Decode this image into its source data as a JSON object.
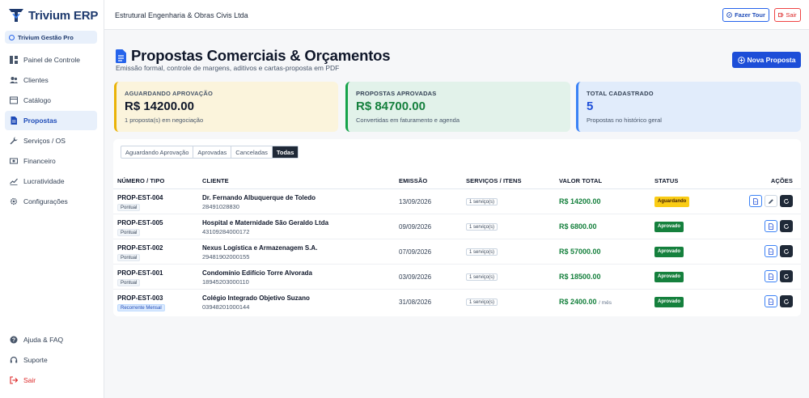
{
  "app": {
    "name": "Trivium ERP",
    "plan": "Trivium Gestão Pro"
  },
  "sidebar": {
    "items": [
      {
        "label": "Painel de Controle",
        "icon": "dashboard-icon",
        "active": false
      },
      {
        "label": "Clientes",
        "icon": "users-icon",
        "active": false
      },
      {
        "label": "Catálogo",
        "icon": "catalog-icon",
        "active": false
      },
      {
        "label": "Propostas",
        "icon": "document-icon",
        "active": true
      },
      {
        "label": "Serviços / OS",
        "icon": "wrench-icon",
        "active": false
      },
      {
        "label": "Financeiro",
        "icon": "money-icon",
        "active": false
      },
      {
        "label": "Lucratividade",
        "icon": "trend-icon",
        "active": false
      },
      {
        "label": "Configurações",
        "icon": "gear-icon",
        "active": false
      }
    ],
    "bottom": [
      {
        "label": "Ajuda & FAQ",
        "icon": "help-icon"
      },
      {
        "label": "Suporte",
        "icon": "headset-icon"
      },
      {
        "label": "Sair",
        "icon": "logout-icon"
      }
    ]
  },
  "topbar": {
    "company": "Estrutural Engenharia & Obras Civis Ltda",
    "tour_label": "Fazer Tour",
    "exit_label": "Sair"
  },
  "header": {
    "title": "Propostas Comerciais & Orçamentos",
    "subtitle": "Emissão formal, controle de margens, aditivos e cartas-proposta em PDF",
    "new_button": "Nova Proposta"
  },
  "stats": [
    {
      "label": "AGUARDANDO APROVAÇÃO",
      "value": "R$ 14200.00",
      "sub": "1 proposta(s) em negociação"
    },
    {
      "label": "PROPOSTAS APROVADAS",
      "value": "R$ 84700.00",
      "sub": "Convertidas em faturamento e agenda"
    },
    {
      "label": "TOTAL CADASTRADO",
      "value": "5",
      "sub": "Propostas no histórico geral"
    }
  ],
  "filters": [
    "Aguardando Aprovação",
    "Aprovadas",
    "Canceladas",
    "Todas"
  ],
  "active_filter": "Todas",
  "table": {
    "columns": [
      "NÚMERO / TIPO",
      "CLIENTE",
      "EMISSÃO",
      "SERVIÇOS / ITENS",
      "VALOR TOTAL",
      "STATUS",
      "AÇÕES"
    ],
    "rows": [
      {
        "number": "PROP-EST-004",
        "type": "Pontual",
        "client": "Dr. Fernando Albuquerque de Toledo",
        "doc": "28491028830",
        "date": "13/09/2026",
        "services": "1 serviço(s)",
        "value": "R$ 14200.00",
        "period": "",
        "status": "Aguardando"
      },
      {
        "number": "PROP-EST-005",
        "type": "Pontual",
        "client": "Hospital e Maternidade São Geraldo Ltda",
        "doc": "43109284000172",
        "date": "09/09/2026",
        "services": "1 serviço(s)",
        "value": "R$ 6800.00",
        "period": "",
        "status": "Aprovado"
      },
      {
        "number": "PROP-EST-002",
        "type": "Pontual",
        "client": "Nexus Logística e Armazenagem S.A.",
        "doc": "29481902000155",
        "date": "07/09/2026",
        "services": "1 serviço(s)",
        "value": "R$ 57000.00",
        "period": "",
        "status": "Aprovado"
      },
      {
        "number": "PROP-EST-001",
        "type": "Pontual",
        "client": "Condomínio Edifício Torre Alvorada",
        "doc": "18945203000110",
        "date": "03/09/2026",
        "services": "1 serviço(s)",
        "value": "R$ 18500.00",
        "period": "",
        "status": "Aprovado"
      },
      {
        "number": "PROP-EST-003",
        "type": "Recorrente Mensal",
        "client": "Colégio Integrado Objetivo Suzano",
        "doc": "03948201000144",
        "date": "31/08/2026",
        "services": "1 serviço(s)",
        "value": "R$ 2400.00",
        "period": "/ mês",
        "status": "Aprovado"
      }
    ]
  },
  "colors": {
    "brand": "#1e3a6e",
    "accent": "#1d4ed8",
    "success": "#15803d",
    "warning": "#facc15",
    "danger": "#dc2626"
  }
}
